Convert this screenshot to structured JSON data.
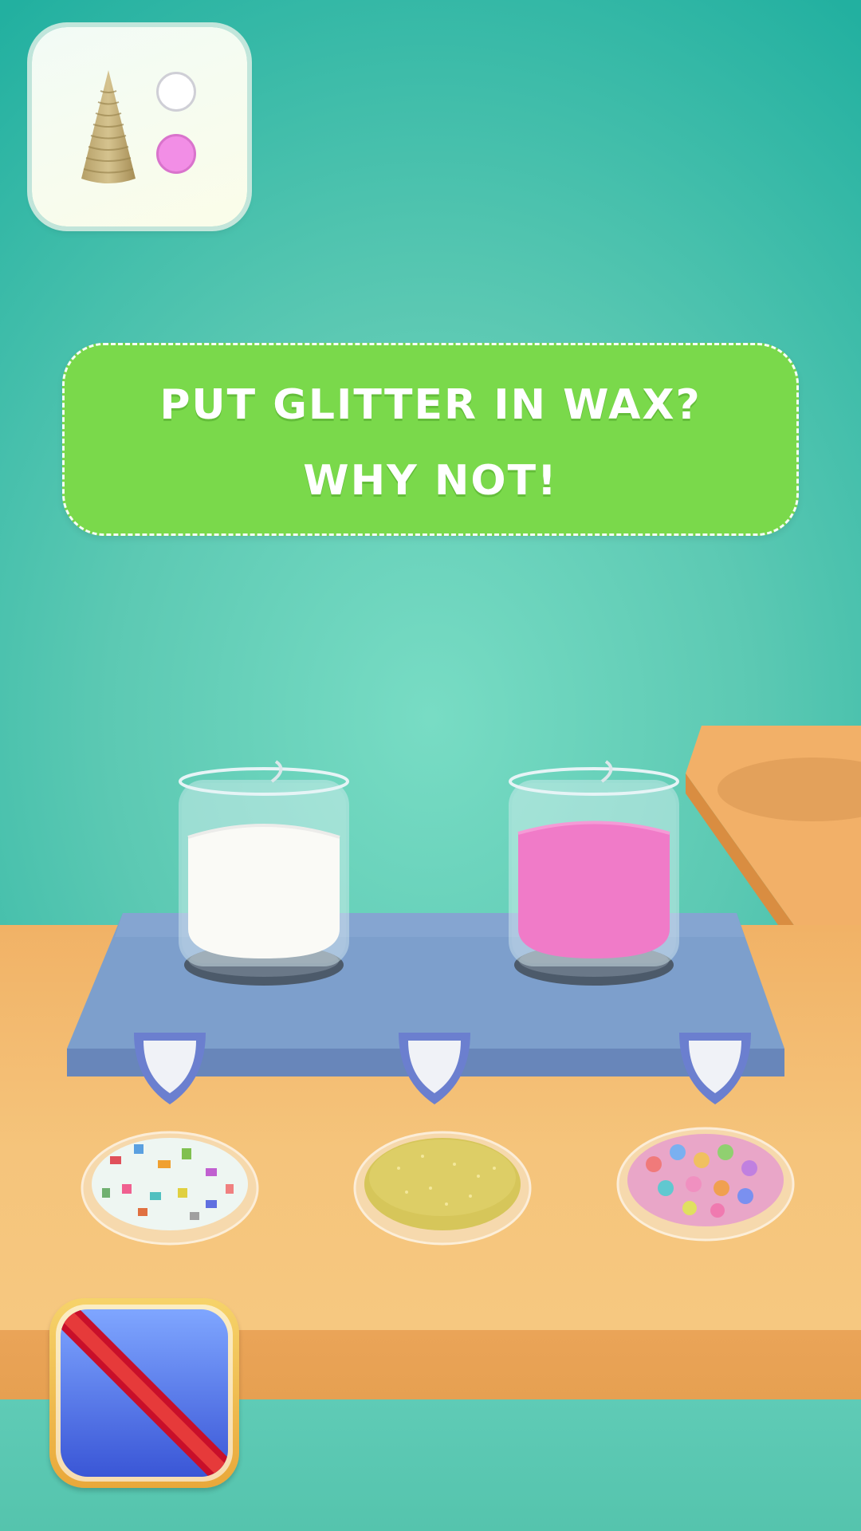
{
  "goal_card": {
    "icon": "wax-cone-icon",
    "swatches": [
      {
        "color": "#ffffff",
        "name": "white-swatch"
      },
      {
        "color": "#f28ee6",
        "name": "pink-swatch"
      }
    ]
  },
  "banner": {
    "line1": "PUT GLITTER IN WAX?",
    "line2": "WHY NOT!",
    "color": "#7ad94b"
  },
  "jars": [
    {
      "wax_color": "#fafaf6",
      "name": "white-wax-jar"
    },
    {
      "wax_color": "#f07bc8",
      "name": "pink-wax-jar"
    }
  ],
  "glitter_options": [
    {
      "name": "confetti-glitter",
      "base": "#eef6f2"
    },
    {
      "name": "gold-glitter",
      "base": "#d6c65a"
    },
    {
      "name": "rainbow-glitter",
      "base": "#e9a6c8"
    }
  ],
  "cancel_button": {
    "icon": "no-glitter-icon"
  }
}
